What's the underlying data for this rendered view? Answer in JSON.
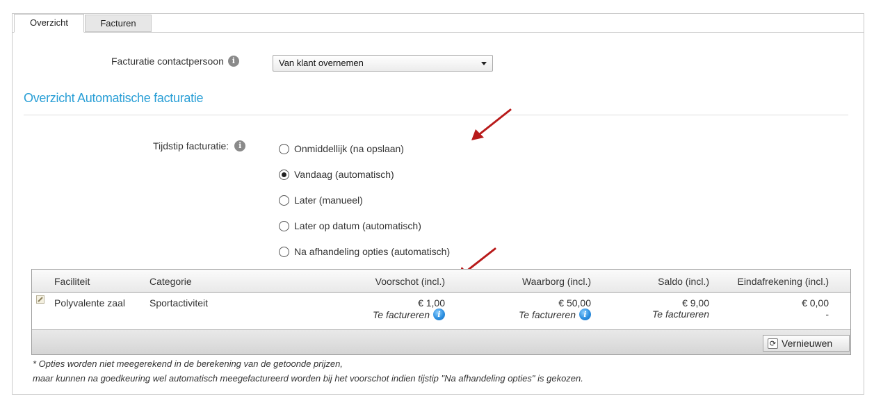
{
  "tabs": [
    {
      "label": "Overzicht",
      "active": true
    },
    {
      "label": "Facturen",
      "active": false
    }
  ],
  "contact": {
    "label": "Facturatie contactpersoon",
    "icon": "info-icon",
    "selected": "Van klant overnemen"
  },
  "section": {
    "title": "Overzicht Automatische facturatie"
  },
  "tijdstip": {
    "label": "Tijdstip facturatie:",
    "icon": "info-icon",
    "options": [
      {
        "label": "Onmiddellijk (na opslaan)",
        "checked": false
      },
      {
        "label": "Vandaag (automatisch)",
        "checked": true
      },
      {
        "label": "Later (manueel)",
        "checked": false
      },
      {
        "label": "Later op datum (automatisch)",
        "checked": false
      },
      {
        "label": "Na afhandeling opties (automatisch)",
        "checked": false
      }
    ]
  },
  "grid": {
    "columns": [
      "Faciliteit",
      "Categorie",
      "Voorschot (incl.)",
      "Waarborg (incl.)",
      "Saldo (incl.)",
      "Eindafrekening (incl.)"
    ],
    "rows": [
      {
        "faciliteit": "Polyvalente zaal",
        "categorie": "Sportactiviteit",
        "voorschot": "€ 1,00",
        "voorschot_status": "Te factureren",
        "waarborg": "€ 50,00",
        "waarborg_status": "Te factureren",
        "saldo": "€ 9,00",
        "saldo_status": "Te factureren",
        "eindafrekening": "€ 0,00",
        "eindafrekening_status": "-"
      }
    ],
    "refresh_label": "Vernieuwen"
  },
  "footnote": {
    "line1": "* Opties worden niet meegerekend in de berekening van de getoonde prijzen,",
    "line2": "maar kunnen na goedkeuring wel automatisch meegefactureerd worden bij het voorschot indien tijstip \"Na afhandeling opties\" is gekozen."
  },
  "colors": {
    "accent": "#2a9fd6",
    "arrow": "#b81a1a"
  }
}
